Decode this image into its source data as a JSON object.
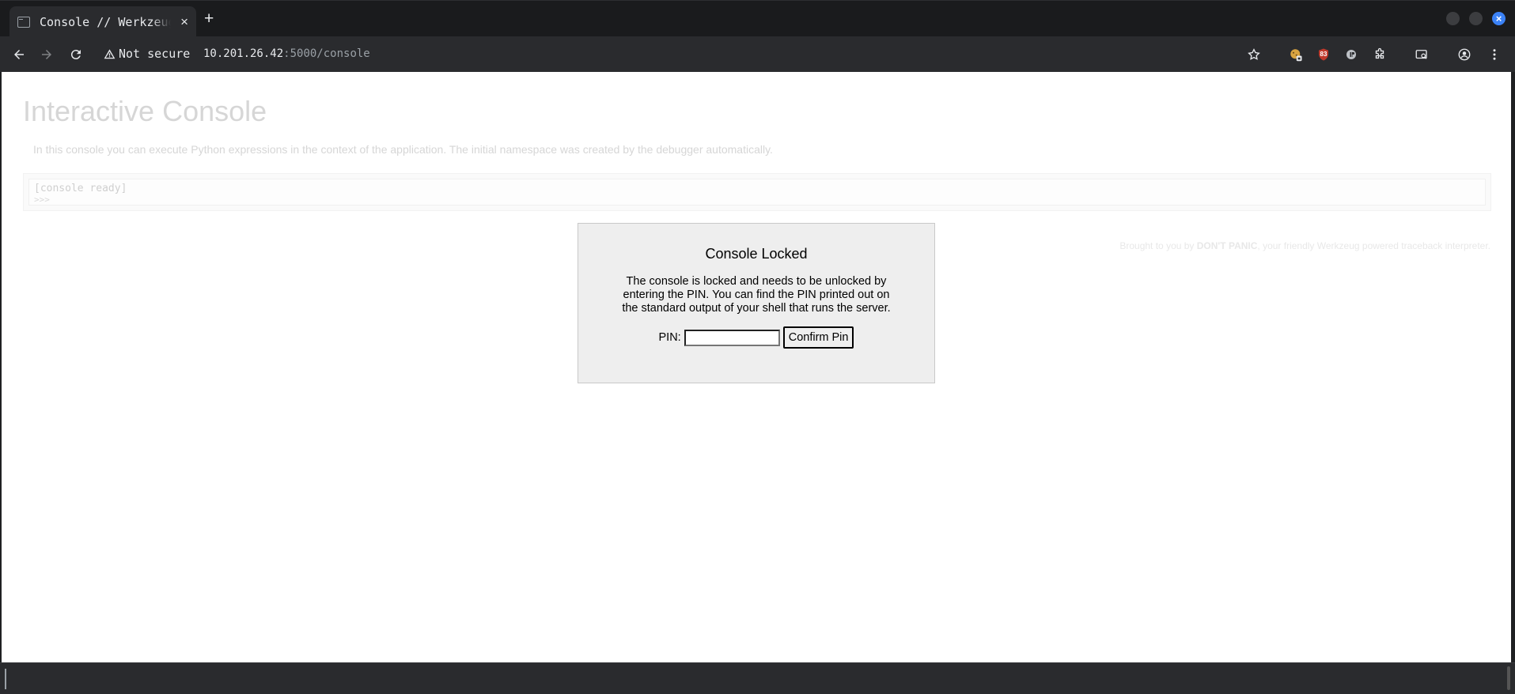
{
  "browser": {
    "tab_title": "Console // Werkzeug",
    "close_symbol": "×",
    "new_tab_symbol": "+",
    "security_label": "Not secure",
    "url_host": "10.201.26.42",
    "url_path": ":5000/console",
    "extension_badge": "83",
    "accent_color": "#3b82f6",
    "icons": [
      "back-arrow-icon",
      "forward-arrow-icon",
      "reload-icon",
      "warning-icon",
      "star-icon",
      "cookie-extension-icon",
      "ublock-extension-icon",
      "extension-icon",
      "puzzle-icon",
      "tab-search-icon",
      "profile-icon",
      "menu-icon"
    ]
  },
  "page": {
    "title": "Interactive Console",
    "intro": "In this console you can execute Python expressions in the context of the application. The initial namespace was created by the debugger automatically.",
    "console_ready": "[console ready]",
    "console_prompt": ">>>",
    "footer_prefix": "Brought to you by ",
    "footer_bold": "DON'T PANIC",
    "footer_suffix": ", your friendly Werkzeug powered traceback interpreter."
  },
  "pin_dialog": {
    "title": "Console Locked",
    "message": "The console is locked and needs to be unlocked by entering the PIN. You can find the PIN printed out on the standard output of your shell that runs the server.",
    "pin_label": "PIN:",
    "pin_value": "",
    "confirm_label": "Confirm Pin"
  }
}
